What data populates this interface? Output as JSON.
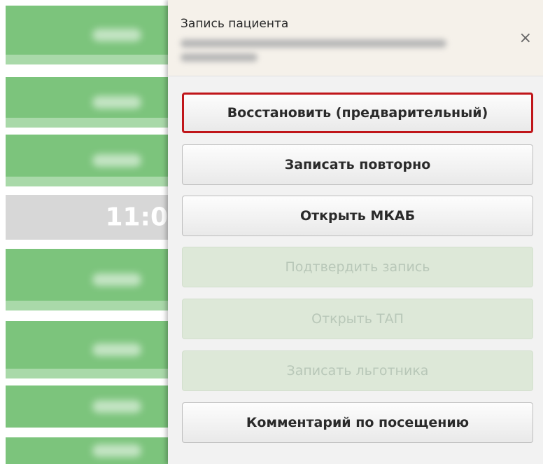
{
  "schedule": {
    "slots": [
      {
        "time": "",
        "state": "booked"
      },
      {
        "time": "",
        "state": "booked"
      },
      {
        "time": "",
        "state": "booked"
      },
      {
        "time": "11:0",
        "state": "selected"
      },
      {
        "time": "",
        "state": "booked"
      },
      {
        "time": "",
        "state": "booked"
      },
      {
        "time": "",
        "state": "booked"
      },
      {
        "time": "",
        "state": "booked"
      }
    ],
    "colors": {
      "booked": "#7cc47c",
      "selected": "#d7d7d7"
    }
  },
  "popup": {
    "title": "Запись пациента",
    "close_icon": "close-icon",
    "buttons": [
      {
        "label": "Восстановить (предварительный)",
        "state": "highlighted"
      },
      {
        "label": "Записать повторно",
        "state": "enabled"
      },
      {
        "label": "Открыть МКАБ",
        "state": "enabled"
      },
      {
        "label": "Подтвердить запись",
        "state": "disabled"
      },
      {
        "label": "Открыть ТАП",
        "state": "disabled"
      },
      {
        "label": "Записать льготника",
        "state": "disabled"
      },
      {
        "label": "Комментарий по посещению",
        "state": "enabled"
      }
    ],
    "highlight_color": "#c0161a"
  }
}
